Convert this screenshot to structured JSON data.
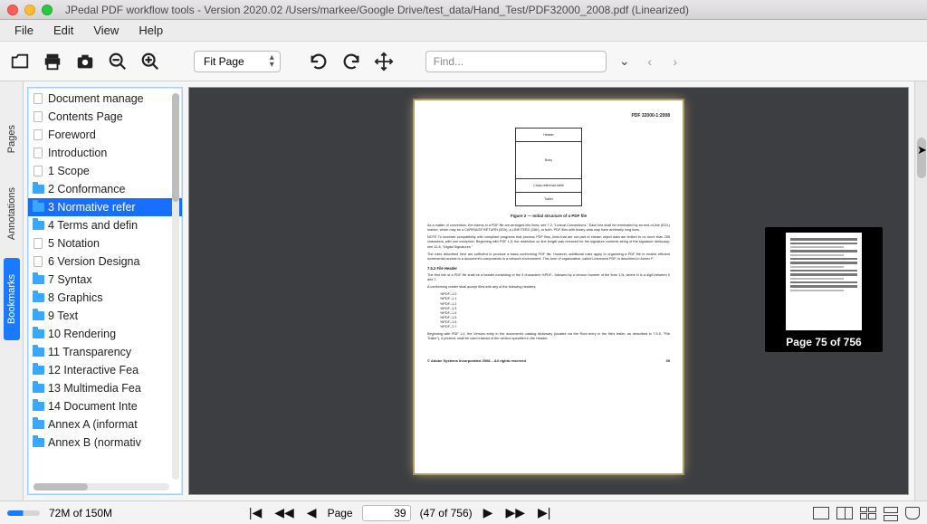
{
  "window": {
    "title": "JPedal PDF workflow tools - Version 2020.02 /Users/markee/Google Drive/test_data/Hand_Test/PDF32000_2008.pdf (Linearized)"
  },
  "menu": [
    "File",
    "Edit",
    "View",
    "Help"
  ],
  "toolbar": {
    "zoom_mode": "Fit Page",
    "find_placeholder": "Find..."
  },
  "side_tabs": {
    "pages": "Pages",
    "annotations": "Annotations",
    "bookmarks": "Bookmarks"
  },
  "bookmarks": [
    {
      "label": "Document manage",
      "type": "doc",
      "selected": false
    },
    {
      "label": "Contents Page",
      "type": "doc",
      "selected": false
    },
    {
      "label": "Foreword",
      "type": "doc",
      "selected": false
    },
    {
      "label": "Introduction",
      "type": "doc",
      "selected": false
    },
    {
      "label": "1 Scope",
      "type": "doc",
      "selected": false
    },
    {
      "label": "2 Conformance",
      "type": "folder",
      "selected": false
    },
    {
      "label": "3 Normative refer",
      "type": "folder",
      "selected": true
    },
    {
      "label": "4 Terms and defin",
      "type": "folder",
      "selected": false
    },
    {
      "label": "5 Notation",
      "type": "doc",
      "selected": false
    },
    {
      "label": "6 Version Designa",
      "type": "doc",
      "selected": false
    },
    {
      "label": "7 Syntax",
      "type": "folder",
      "selected": false
    },
    {
      "label": "8 Graphics",
      "type": "folder",
      "selected": false
    },
    {
      "label": "9 Text",
      "type": "folder",
      "selected": false
    },
    {
      "label": "10 Rendering",
      "type": "folder",
      "selected": false
    },
    {
      "label": "11 Transparency",
      "type": "folder",
      "selected": false
    },
    {
      "label": "12 Interactive Fea",
      "type": "folder",
      "selected": false
    },
    {
      "label": "13 Multimedia Fea",
      "type": "folder",
      "selected": false
    },
    {
      "label": "14 Document Inte",
      "type": "folder",
      "selected": false
    },
    {
      "label": "Annex A (informat",
      "type": "folder",
      "selected": false
    },
    {
      "label": "Annex B (normativ",
      "type": "folder",
      "selected": false
    }
  ],
  "page": {
    "header_id": "PDF 32000-1:2008",
    "structure": {
      "h": "Header",
      "b": "Body",
      "x": "Cross-reference table",
      "t": "Trailer"
    },
    "figure_caption": "Figure 2 — Initial structure of a PDF file",
    "p1": "As a matter of convention, the tokens in a PDF file are arranged into lines; see 7.2, \"Lexical Conventions.\" Each line shall be terminated by an end-of-line (EOL) marker, which may be a CARRIAGE RETURN (0Dh), a LINE FEED (0Ah), or both. PDF files with binary data may have arbitrarily long lines.",
    "note": "NOTE   To increase compatibility with compliant programs that process PDF files, lines that are not part of stream object data are limited to no more than 255 characters, with one exception. Beginning with PDF 1.3, the restriction on line length was removed for the signature contents string of the signature dictionary; see 12.8, \"Digital Signatures.\"",
    "p2": "The rules described here are sufficient to produce a basic conforming PDF file. However, additional rules apply to organizing a PDF file to enable efficient incremental access to a document's components in a network environment. This form of organization, called Linearized PDF, is described in Annex F.",
    "sec": "7.5.2   File Header",
    "p3": "The first line of a PDF file shall be a header consisting of the 5 characters  %PDF–  followed by a version number of the form 1.N, where N is a digit between 0 and 7.",
    "p4": "A conforming reader shall accept files with any of the following headers:",
    "headers": [
      "%PDF–1.0",
      "%PDF–1.1",
      "%PDF–1.2",
      "%PDF–1.3",
      "%PDF–1.4",
      "%PDF–1.5",
      "%PDF–1.6",
      "%PDF–1.7"
    ],
    "p5": "Beginning with PDF 1.4, the Version entry in the document's catalog dictionary (located via the Root entry in the file's trailer, as described in 7.5.5, \"File Trailer\"), if present, shall be used instead of the version specified in the Header.",
    "footer_left": "© Adobe Systems Incorporated 2008 – All rights reserved",
    "footer_right": "39"
  },
  "thumb": {
    "caption": "Page 75 of 756"
  },
  "status": {
    "memory": "72M of 150M",
    "page_label": "Page",
    "page_value": "39",
    "page_count": "(47 of 756)"
  }
}
